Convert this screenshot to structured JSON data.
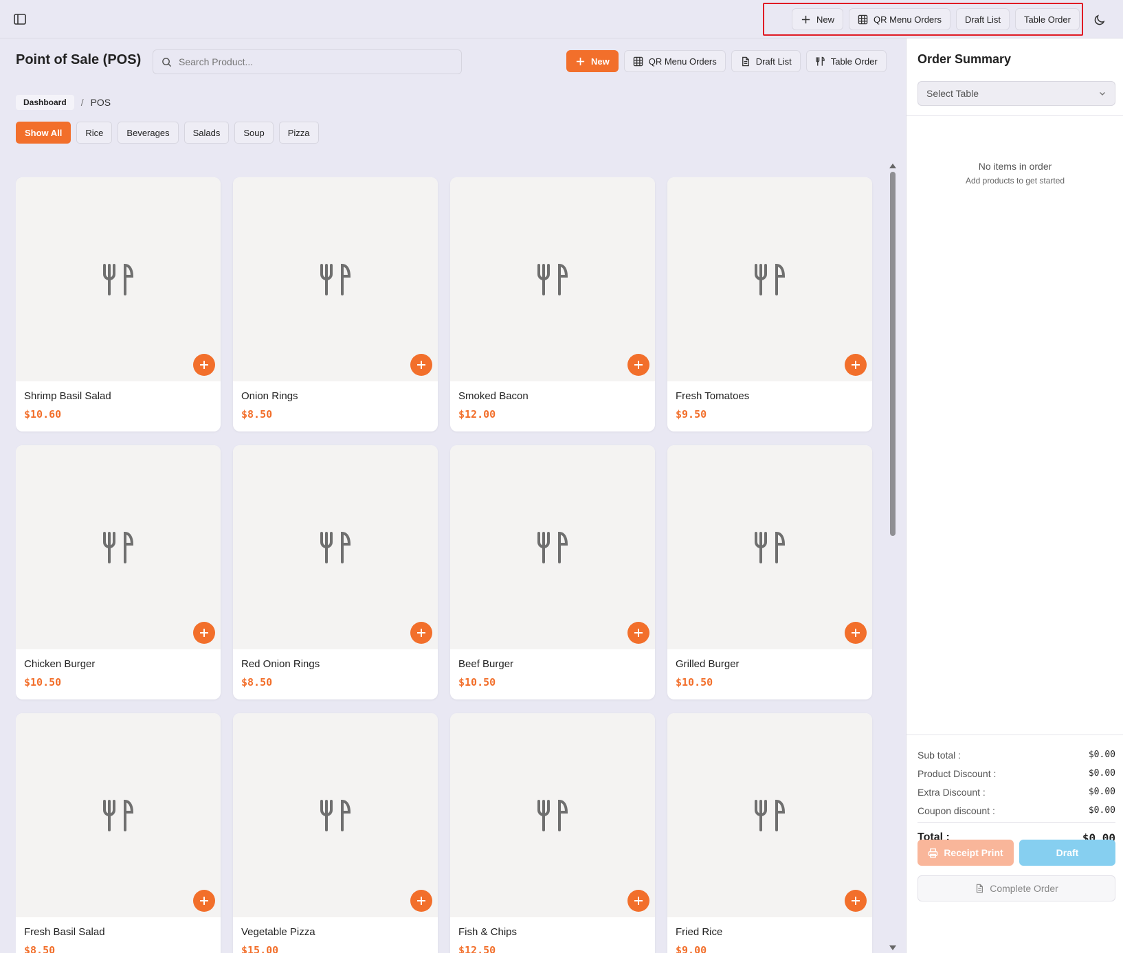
{
  "topbar": {
    "new_label": "New",
    "qr_label": "QR Menu Orders",
    "draft_label": "Draft List",
    "table_label": "Table Order"
  },
  "header": {
    "title": "Point of Sale (POS)",
    "search_placeholder": "Search Product...",
    "new_label": "New",
    "qr_label": "QR Menu Orders",
    "draft_label": "Draft List",
    "table_label": "Table Order"
  },
  "breadcrumb": {
    "home": "Dashboard",
    "separator": "/",
    "current": "POS"
  },
  "categories": [
    "Show All",
    "Rice",
    "Beverages",
    "Salads",
    "Soup",
    "Pizza"
  ],
  "active_category": "Show All",
  "colors": {
    "accent": "#f26f2b",
    "draft": "#86cff0",
    "background": "#e9e8f3"
  },
  "products": [
    {
      "name": "Shrimp Basil Salad",
      "price": "$10.60"
    },
    {
      "name": "Onion Rings",
      "price": "$8.50"
    },
    {
      "name": "Smoked Bacon",
      "price": "$12.00"
    },
    {
      "name": "Fresh Tomatoes",
      "price": "$9.50"
    },
    {
      "name": "Chicken Burger",
      "price": "$10.50"
    },
    {
      "name": "Red Onion Rings",
      "price": "$8.50"
    },
    {
      "name": "Beef Burger",
      "price": "$10.50"
    },
    {
      "name": "Grilled Burger",
      "price": "$10.50"
    },
    {
      "name": "Fresh Basil Salad",
      "price": "$8.50"
    },
    {
      "name": "Vegetable Pizza",
      "price": "$15.00"
    },
    {
      "name": "Fish & Chips",
      "price": "$12.50"
    },
    {
      "name": "Fried Rice",
      "price": "$9.00"
    }
  ],
  "order": {
    "title": "Order Summary",
    "table_placeholder": "Select Table",
    "empty_title": "No items in order",
    "empty_subtitle": "Add products to get started",
    "subtotal_label": "Sub total :",
    "subtotal": "$0.00",
    "product_discount_label": "Product Discount :",
    "product_discount": "$0.00",
    "extra_discount_label": "Extra Discount :",
    "extra_discount": "$0.00",
    "coupon_discount_label": "Coupon discount :",
    "coupon_discount": "$0.00",
    "total_label": "Total :",
    "total": "$0.00",
    "receipt_label": "Receipt Print",
    "draft_label": "Draft",
    "complete_label": "Complete Order"
  }
}
